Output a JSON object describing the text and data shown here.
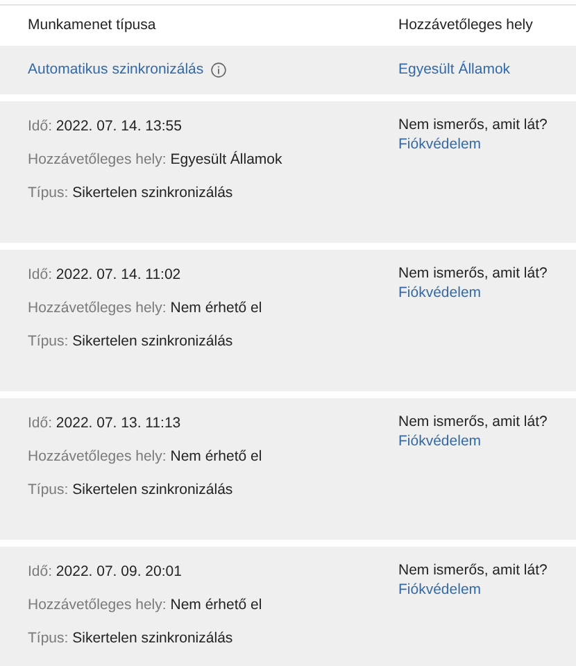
{
  "columns": [
    "Munkamenet típusa",
    "Hozzávetőleges hely"
  ],
  "summary": {
    "session_type": "Automatikus szinkronizálás",
    "location": "Egyesült Államok"
  },
  "entries": [
    {
      "fields": [
        {
          "label": "Idő:",
          "value": "2022. 07. 14. 13:55"
        },
        {
          "label": "Hozzávetőleges hely:",
          "value": "Egyesült Államok"
        },
        {
          "label": "Típus:",
          "value": "Sikertelen szinkronizálás"
        }
      ],
      "question": "Nem ismerős, amit lát?",
      "link": "Fiókvédelem"
    },
    {
      "fields": [
        {
          "label": "Idő:",
          "value": "2022. 07. 14. 11:02"
        },
        {
          "label": "Hozzávetőleges hely:",
          "value": "Nem érhető el"
        },
        {
          "label": "Típus:",
          "value": "Sikertelen szinkronizálás"
        }
      ],
      "question": "Nem ismerős, amit lát?",
      "link": "Fiókvédelem"
    },
    {
      "fields": [
        {
          "label": "Idő:",
          "value": "2022. 07. 13. 11:13"
        },
        {
          "label": "Hozzávetőleges hely:",
          "value": "Nem érhető el"
        },
        {
          "label": "Típus:",
          "value": "Sikertelen szinkronizálás"
        }
      ],
      "question": "Nem ismerős, amit lát?",
      "link": "Fiókvédelem"
    },
    {
      "fields": [
        {
          "label": "Idő:",
          "value": "2022. 07. 09. 20:01"
        },
        {
          "label": "Hozzávetőleges hely:",
          "value": "Nem érhető el"
        },
        {
          "label": "Típus:",
          "value": "Sikertelen szinkronizálás"
        }
      ],
      "question": "Nem ismerős, amit lát?",
      "link": "Fiókvédelem"
    }
  ]
}
